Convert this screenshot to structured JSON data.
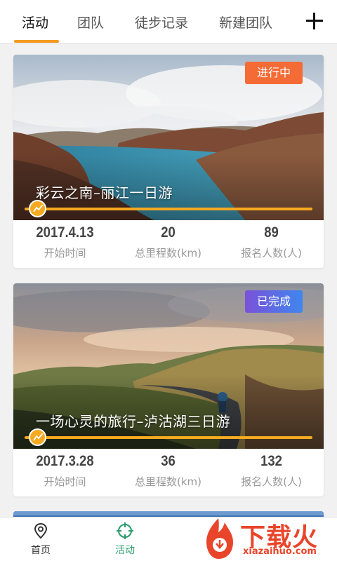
{
  "tabs": [
    {
      "label": "活动",
      "active": true
    },
    {
      "label": "团队",
      "active": false
    },
    {
      "label": "徒步记录",
      "active": false
    },
    {
      "label": "新建团队",
      "active": false
    }
  ],
  "activities": [
    {
      "status": "进行中",
      "title": "彩云之南–丽江一日游",
      "date": "2017.4.13",
      "date_label": "开始时间",
      "distance": "20",
      "distance_label": "总里程数(km)",
      "signups": "89",
      "signups_label": "报名人数(人)"
    },
    {
      "status": "已完成",
      "title": "一场心灵的旅行–泸沽湖三日游",
      "date": "2017.3.28",
      "date_label": "开始时间",
      "distance": "36",
      "distance_label": "总里程数(km)",
      "signups": "132",
      "signups_label": "报名人数(人)"
    }
  ],
  "bottom_nav": [
    {
      "label": "首页",
      "icon": "map-pin-icon",
      "active": false
    },
    {
      "label": "活动",
      "icon": "crosshair-icon",
      "active": true
    }
  ],
  "watermark": {
    "text": "下载火",
    "sub": "xiazaihuo.com"
  },
  "colors": {
    "accent": "#f39a1e",
    "ongoing": "#f46b35",
    "done": "#5c6ee3",
    "nav_active": "#2b9a6c"
  }
}
